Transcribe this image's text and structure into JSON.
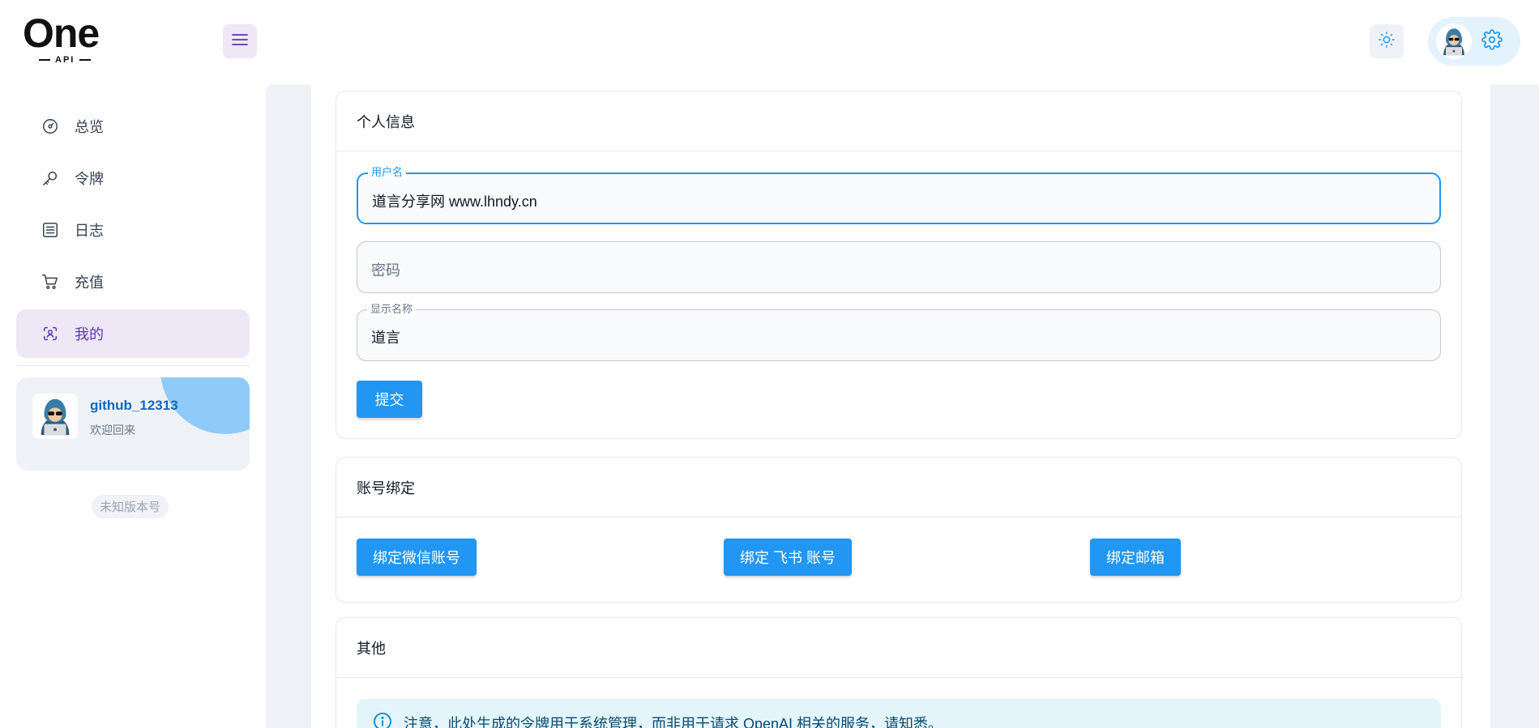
{
  "header": {
    "logo_main": "One",
    "logo_sub": "API"
  },
  "sidebar": {
    "items": [
      {
        "label": "总览",
        "icon": "dashboard-icon",
        "active": false
      },
      {
        "label": "令牌",
        "icon": "key-icon",
        "active": false
      },
      {
        "label": "日志",
        "icon": "log-list-icon",
        "active": false
      },
      {
        "label": "充值",
        "icon": "cart-icon",
        "active": false
      },
      {
        "label": "我的",
        "icon": "user-scan-icon",
        "active": true
      }
    ],
    "user": {
      "name": "github_12313",
      "welcome": "欢迎回来"
    },
    "version": "未知版本号"
  },
  "profile_card": {
    "title": "个人信息",
    "username_label": "用户名",
    "username_value": "道言分享网 www.lhndy.cn",
    "password_placeholder": "密码",
    "display_name_label": "显示名称",
    "display_name_value": "道言",
    "submit_label": "提交"
  },
  "binding_card": {
    "title": "账号绑定",
    "wechat_label": "绑定微信账号",
    "feishu_label": "绑定 飞书 账号",
    "email_label": "绑定邮箱"
  },
  "other_card": {
    "title": "其他",
    "notice": "注意，此处生成的令牌用于系统管理，而非用于请求 OpenAI 相关的服务，请知悉。"
  },
  "colors": {
    "primary": "#2196f3",
    "secondary": "#5e35b1",
    "secondary_light": "#ede7f6",
    "background": "#eef2f6"
  }
}
